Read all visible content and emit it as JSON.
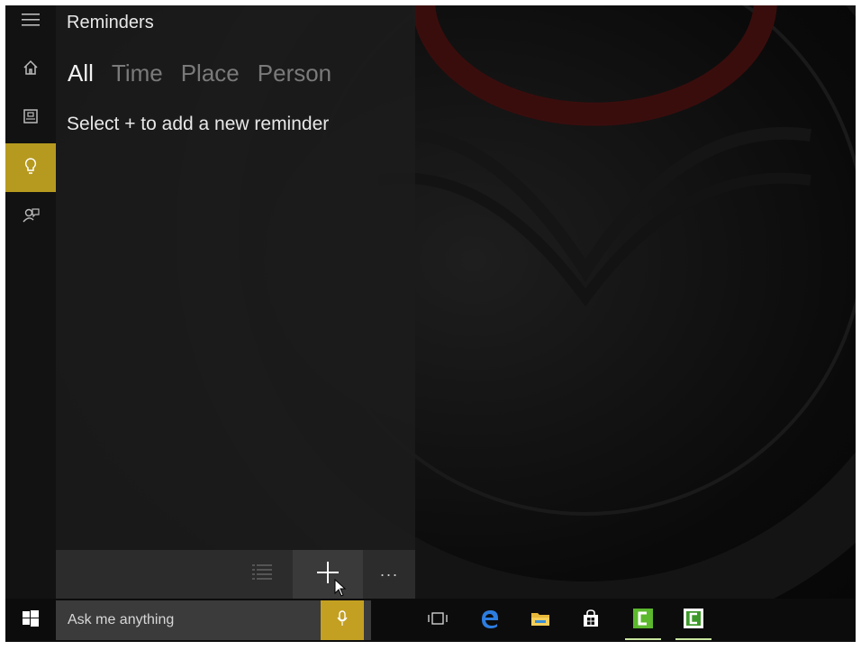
{
  "panel": {
    "title": "Reminders",
    "filters": [
      {
        "label": "All",
        "selected": true
      },
      {
        "label": "Time",
        "selected": false
      },
      {
        "label": "Place",
        "selected": false
      },
      {
        "label": "Person",
        "selected": false
      }
    ],
    "empty_message": "Select + to add a new reminder",
    "more_label": "···"
  },
  "rail": {
    "items": [
      "menu-icon",
      "home-icon",
      "notebook-icon",
      "reminder-bulb-icon",
      "feedback-icon"
    ],
    "active": "reminder-bulb-icon"
  },
  "taskbar": {
    "search_placeholder": "Ask me anything",
    "pinned": [
      "task-view-icon",
      "edge-icon",
      "file-explorer-icon",
      "store-icon",
      "camtasia-recorder-icon",
      "camtasia-studio-icon"
    ]
  },
  "colors": {
    "accent": "#b69a1f",
    "panel_bg": "#1c1c1c",
    "taskbar_bg": "#0c0c0c",
    "search_bg": "#3b3b3b",
    "edge_blue": "#2d7de0",
    "camtasia_green": "#5cb82d"
  }
}
